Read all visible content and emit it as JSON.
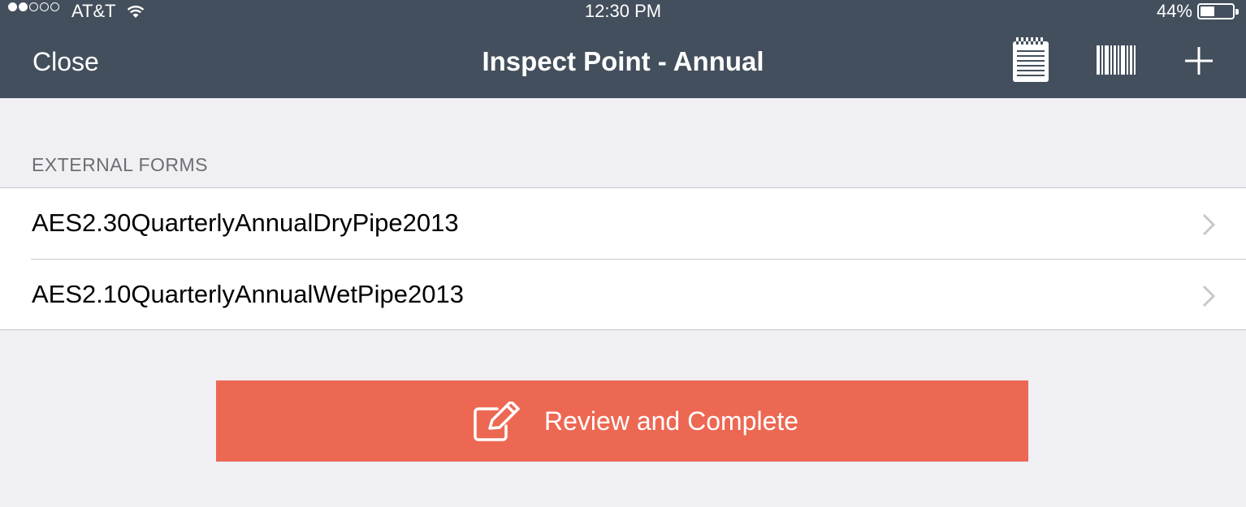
{
  "status_bar": {
    "carrier": "AT&T",
    "time": "12:30 PM",
    "battery_percent": "44%",
    "signal_bars_filled": 2,
    "signal_bars_total": 5,
    "battery_level": 0.44
  },
  "nav": {
    "close_label": "Close",
    "title": "Inspect Point - Annual",
    "icons": [
      "notes-icon",
      "barcode-icon",
      "plus-icon"
    ]
  },
  "section": {
    "header": "EXTERNAL FORMS",
    "items": [
      {
        "label": "AES2.30QuarterlyAnnualDryPipe2013"
      },
      {
        "label": "AES2.10QuarterlyAnnualWetPipe2013"
      }
    ]
  },
  "action": {
    "label": "Review and Complete",
    "icon": "edit-icon",
    "color": "#ed6853"
  },
  "colors": {
    "nav_background": "#434f5c",
    "page_background": "#efeff4"
  }
}
